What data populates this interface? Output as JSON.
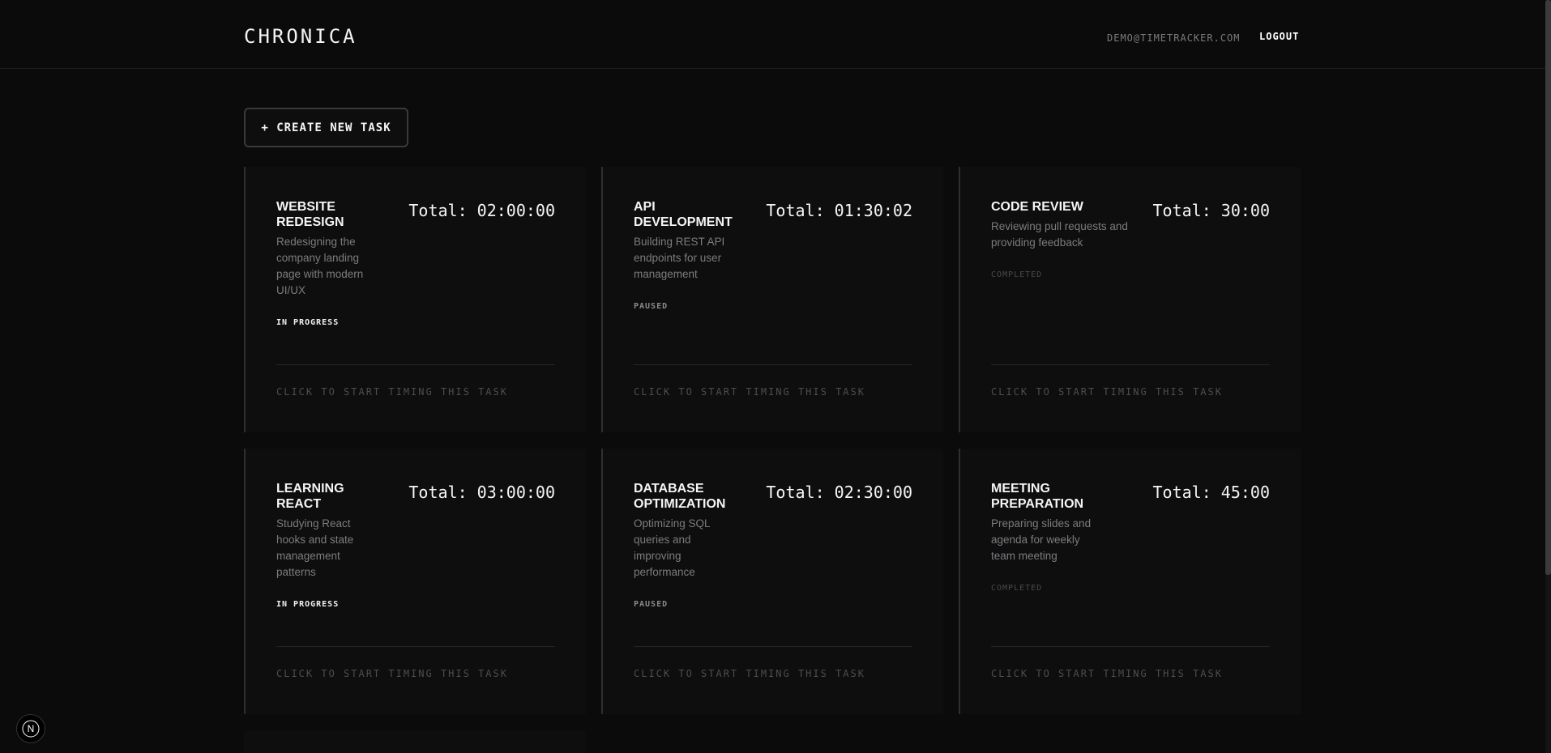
{
  "header": {
    "brand": "CHRONICA",
    "user_email": "DEMO@TIMETRACKER.COM",
    "logout_label": "LOGOUT"
  },
  "actions": {
    "create_label": "+ CREATE NEW TASK"
  },
  "tasks": [
    {
      "title": "WEBSITE REDESIGN",
      "total": "Total: 02:00:00",
      "description": "Redesigning the company landing page with modern UI/UX",
      "status": "IN PROGRESS",
      "cta": "CLICK TO START TIMING THIS TASK"
    },
    {
      "title": "API DEVELOPMENT",
      "total": "Total: 01:30:02",
      "description": "Building REST API endpoints for user management",
      "status": "PAUSED",
      "cta": "CLICK TO START TIMING THIS TASK"
    },
    {
      "title": "CODE REVIEW",
      "total": "Total: 30:00",
      "description": "Reviewing pull requests and providing feedback",
      "status": "COMPLETED",
      "cta": "CLICK TO START TIMING THIS TASK"
    },
    {
      "title": "LEARNING REACT",
      "total": "Total: 03:00:00",
      "description": "Studying React hooks and state management patterns",
      "status": "IN PROGRESS",
      "cta": "CLICK TO START TIMING THIS TASK"
    },
    {
      "title": "DATABASE OPTIMIZATION",
      "total": "Total: 02:30:00",
      "description": "Optimizing SQL queries and improving performance",
      "status": "PAUSED",
      "cta": "CLICK TO START TIMING THIS TASK"
    },
    {
      "title": "MEETING PREPARATION",
      "total": "Total: 45:00",
      "description": "Preparing slides and agenda for weekly team meeting",
      "status": "COMPLETED",
      "cta": "CLICK TO START TIMING THIS TASK"
    }
  ],
  "colors": {
    "background": "#0b0b0c",
    "card": "#0e0e0f",
    "text": "#f5f5f5",
    "muted": "#7c7c80"
  },
  "icons": {
    "dev_badge": "next-logo-icon"
  },
  "dev_badge_letter": "N"
}
